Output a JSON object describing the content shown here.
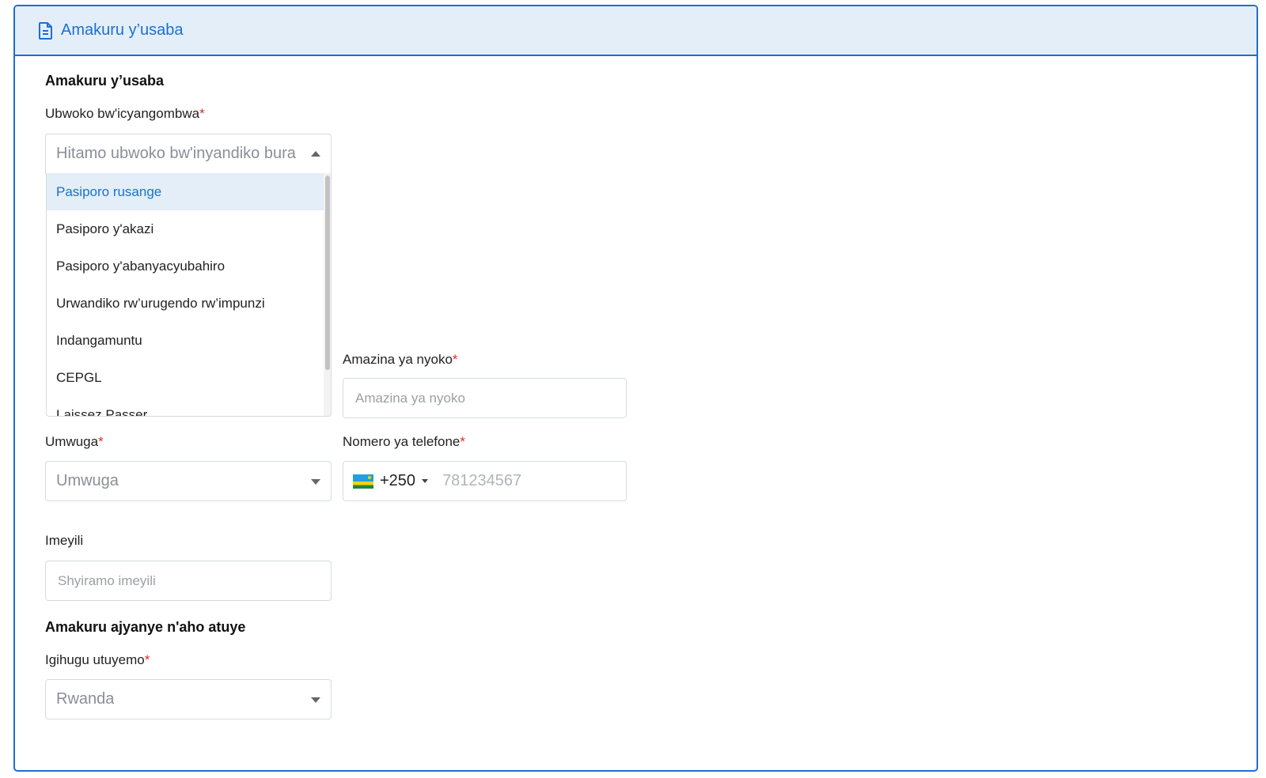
{
  "header": {
    "title": "Amakuru y’usaba",
    "icon": "document-icon"
  },
  "section_applicant": {
    "title": "Amakuru y’usaba"
  },
  "document_type": {
    "label": "Ubwoko bw'icyangombwa",
    "required_mark": "*",
    "placeholder": "Hitamo ubwoko bw'inyandiko bura",
    "options": [
      "Pasiporo rusange",
      "Pasiporo y'akazi",
      "Pasiporo y'abanyacyubahiro",
      "Urwandiko rw’urugendo rw’impunzi",
      "Indangamuntu",
      "CEPGL",
      "Laissez Passer"
    ],
    "highlighted": "Pasiporo rusange"
  },
  "mother_name": {
    "label": "Amazina ya nyoko",
    "required_mark": "*",
    "placeholder": "Amazina ya nyoko"
  },
  "occupation": {
    "label": "Umwuga",
    "required_mark": "*",
    "value": "Umwuga"
  },
  "phone": {
    "label": "Nomero ya telefone",
    "required_mark": "*",
    "code": "+250",
    "placeholder": "781234567"
  },
  "email": {
    "label": "Imeyili",
    "placeholder": "Shyiramo imeyili"
  },
  "section_residence": {
    "title": "Amakuru ajyanye n'aho atuye"
  },
  "country": {
    "label": "Igihugu utuyemo",
    "required_mark": "*",
    "value": "Rwanda"
  },
  "colors": {
    "accent": "#1d6fd1",
    "header_bg": "#e3eef9",
    "required": "#e02b2b"
  }
}
